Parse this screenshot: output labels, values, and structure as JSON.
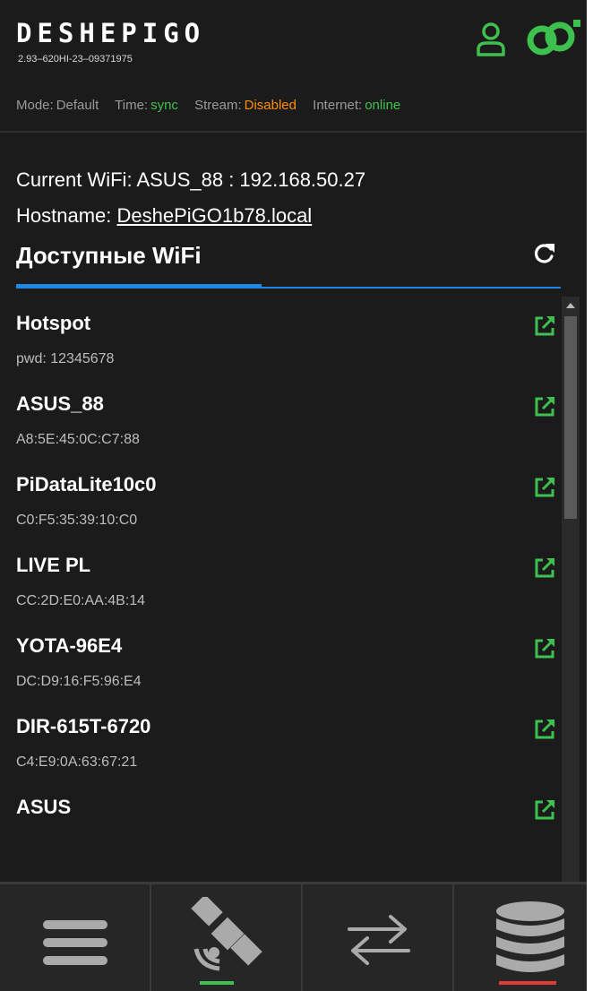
{
  "header": {
    "brand": "DESHEPIGO",
    "version": "2.93–620HI-23–09371975",
    "status": {
      "mode_label": "Mode:",
      "mode_value": "Default",
      "time_label": "Time:",
      "time_value": "sync",
      "stream_label": "Stream:",
      "stream_value": "Disabled",
      "internet_label": "Internet:",
      "internet_value": "online"
    }
  },
  "main": {
    "current_wifi": "Current WiFi: ASUS_88 : 192.168.50.27",
    "hostname_label": "Hostname:",
    "hostname_value": "DeshePiGO1b78.local",
    "section_title": "Доступные WiFi",
    "networks": [
      {
        "name": "Hotspot",
        "sub": "pwd: 12345678"
      },
      {
        "name": "ASUS_88",
        "sub": "A8:5E:45:0C:C7:88"
      },
      {
        "name": "PiDataLite10c0",
        "sub": "C0:F5:35:39:10:C0"
      },
      {
        "name": "LIVE PL",
        "sub": "CC:2D:E0:AA:4B:14"
      },
      {
        "name": "YOTA-96E4",
        "sub": "DC:D9:16:F5:96:E4"
      },
      {
        "name": "DIR-615T-6720",
        "sub": "C4:E9:0A:63:67:21"
      },
      {
        "name": "ASUS",
        "sub": ""
      }
    ]
  },
  "nav": {
    "items": [
      {
        "icon": "menu-icon"
      },
      {
        "icon": "satellite-icon",
        "active": true,
        "indicator_color": "#3ec04f"
      },
      {
        "icon": "transfer-icon"
      },
      {
        "icon": "database-icon",
        "indicator_color": "#e53935"
      }
    ]
  },
  "colors": {
    "background": "#1b1b1b",
    "accent_green": "#3ec04f",
    "accent_orange": "#ff8c00",
    "tab_blue": "#1e88e5"
  }
}
